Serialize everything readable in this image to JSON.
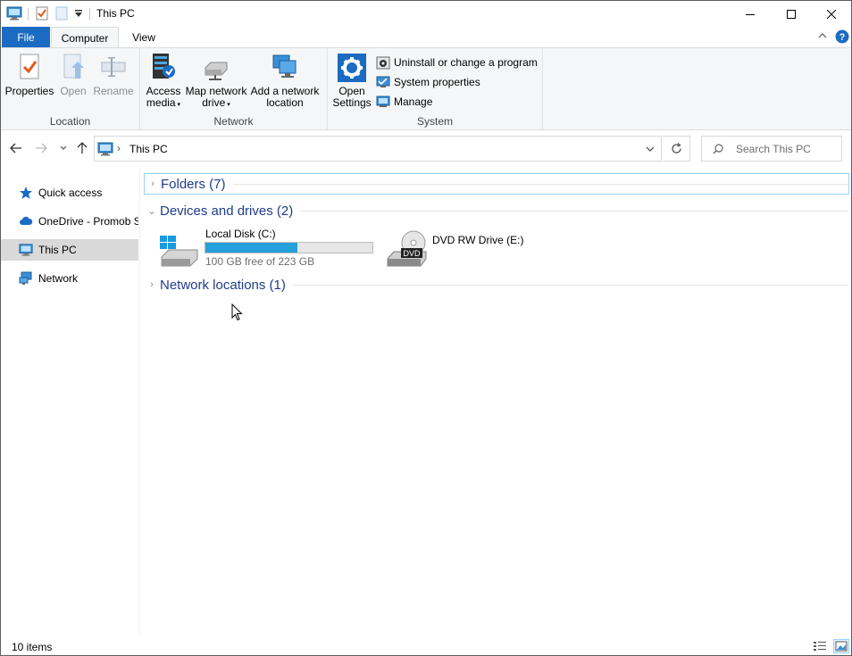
{
  "window": {
    "title": "This PC",
    "controls": {
      "minimize": "minimize",
      "maximize": "maximize",
      "close": "close"
    }
  },
  "ribbon": {
    "tabs": [
      {
        "label": "File"
      },
      {
        "label": "Computer"
      },
      {
        "label": "View"
      }
    ],
    "groups": {
      "location": {
        "label": "Location",
        "properties": "Properties",
        "open": "Open",
        "rename": "Rename"
      },
      "network": {
        "label": "Network",
        "access_media_1": "Access",
        "access_media_2": "media",
        "map_drive_1": "Map network",
        "map_drive_2": "drive",
        "add_location_1": "Add a network",
        "add_location_2": "location"
      },
      "system": {
        "label": "System",
        "open_settings_1": "Open",
        "open_settings_2": "Settings",
        "uninstall": "Uninstall or change a program",
        "system_properties": "System properties",
        "manage": "Manage"
      }
    }
  },
  "address": {
    "path": "This PC",
    "search_placeholder": "Search This PC"
  },
  "nav": {
    "items": [
      {
        "label": "Quick access"
      },
      {
        "label": "OneDrive - Promob S"
      },
      {
        "label": "This PC"
      },
      {
        "label": "Network"
      }
    ]
  },
  "content": {
    "folders_header": "Folders (7)",
    "devices_header": "Devices and drives (2)",
    "network_header": "Network locations (1)",
    "drives": [
      {
        "name": "Local Disk (C:)",
        "free_text": "100 GB free of 223 GB",
        "used_fraction": 0.55
      },
      {
        "name": "DVD RW Drive (E:)",
        "badge": "DVD"
      }
    ]
  },
  "status": {
    "item_count": "10 items"
  },
  "colors": {
    "accent": "#1a6bc1",
    "drive_bar": "#26a0da",
    "group_header": "#1f3b8c"
  }
}
